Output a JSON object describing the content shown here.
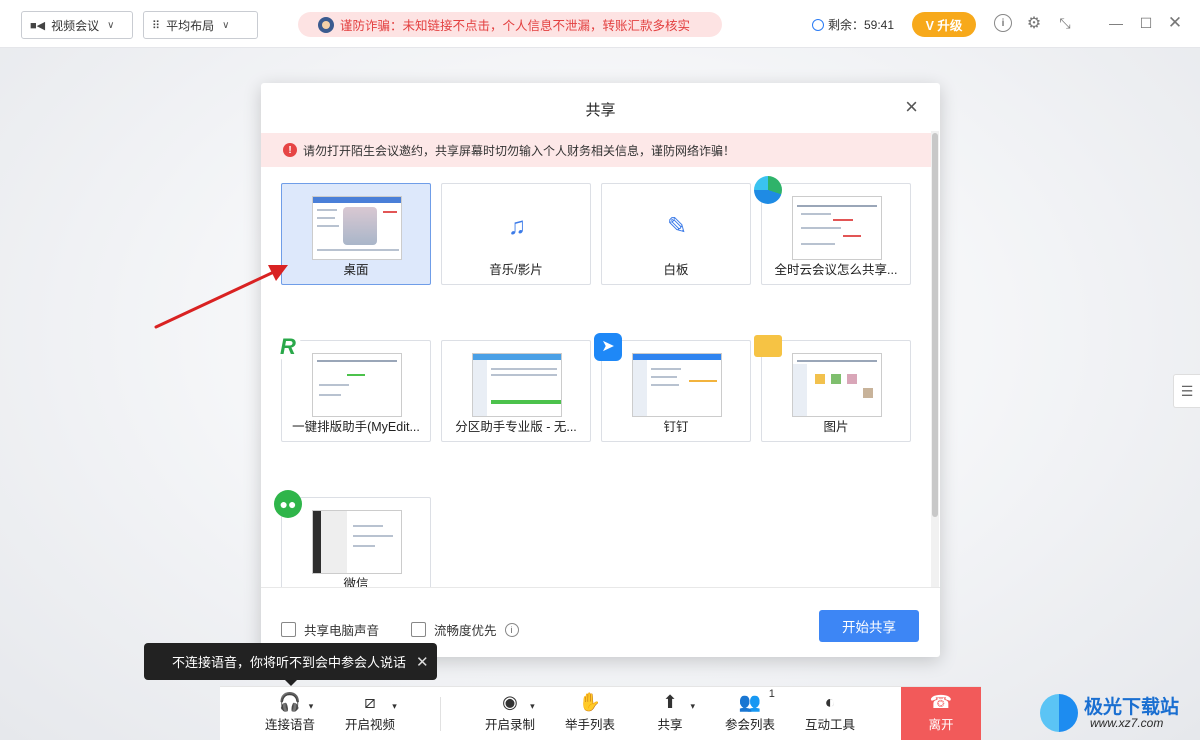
{
  "topbar": {
    "meeting_type": "视频会议",
    "layout": "平均布局",
    "fraud_notice": "谨防诈骗：未知链接不点击，个人信息不泄漏，转账汇款多核实",
    "time_remaining": "剩余：59:41",
    "upgrade_label": "V 升级"
  },
  "share_dialog": {
    "title": "共享",
    "close_glyph": "×",
    "warning": "请勿打开陌生会议邀约，共享屏幕时切勿输入个人财务相关信息，谨防网络诈骗！",
    "tiles": [
      {
        "label": "桌面",
        "kind": "desktop",
        "selected": true
      },
      {
        "label": "音乐/影片",
        "kind": "music-icon",
        "glyph": "♫"
      },
      {
        "label": "白板",
        "kind": "pencil-icon",
        "glyph": "✎"
      },
      {
        "label": "全时云会议怎么共享...",
        "kind": "edge-window"
      },
      {
        "label": "一键排版助手(MyEdit...",
        "kind": "myedit-window"
      },
      {
        "label": "分区助手专业版 - 无...",
        "kind": "partition-window"
      },
      {
        "label": "钉钉",
        "kind": "dingtalk-window"
      },
      {
        "label": "图片",
        "kind": "folder-window"
      },
      {
        "label": "微信",
        "kind": "wechat-window"
      }
    ],
    "share_audio_label": "共享电脑声音",
    "fluency_label": "流畅度优先",
    "start_button": "开始共享"
  },
  "tooltip": {
    "text": "不连接语音，你将听不到会中参会人说话",
    "close_glyph": "✕"
  },
  "toolbar": {
    "connect_audio": "连接语音",
    "start_video": "开启视频",
    "start_record": "开启录制",
    "raise_hand": "举手列表",
    "share": "共享",
    "participants": "参会列表",
    "participant_count": "1",
    "interactive_tools": "互动工具",
    "leave": "离开"
  },
  "watermark": {
    "brand": "极光下载站",
    "url": "www.xz7.com"
  },
  "colors": {
    "accent": "#3d86f5",
    "leave_red": "#f25a5a",
    "upgrade_orange": "#f7a91b",
    "warning_bg": "#fde8e8"
  }
}
